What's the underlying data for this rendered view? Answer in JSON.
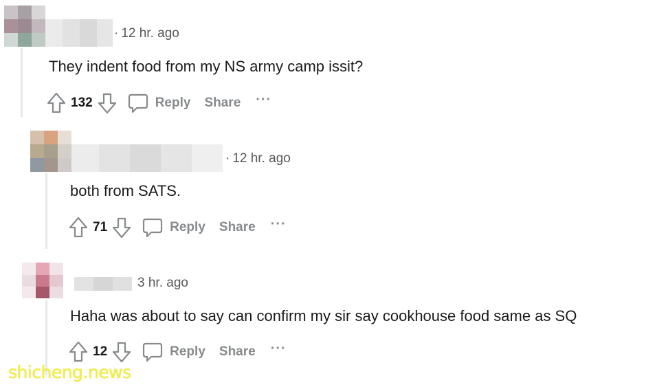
{
  "comments": [
    {
      "timestamp": "12 hr. ago",
      "body": "They indent food from my NS army camp issit?",
      "score": "132",
      "reply_label": "Reply",
      "share_label": "Share",
      "more_label": "···"
    },
    {
      "timestamp": "12 hr. ago",
      "body": "both from SATS.",
      "score": "71",
      "reply_label": "Reply",
      "share_label": "Share",
      "more_label": "···"
    },
    {
      "timestamp": "3 hr. ago",
      "body": "Haha was about to say can confirm my sir say cookhouse food same as SQ",
      "score": "12",
      "reply_label": "Reply",
      "share_label": "Share",
      "more_label": "···"
    }
  ],
  "icons": {
    "upvote": "upvote-arrow-icon",
    "downvote": "downvote-arrow-icon",
    "reply": "speech-bubble-icon",
    "more": "ellipsis-icon"
  },
  "colors": {
    "action_gray": "#878a8c",
    "thread_line": "#e6e7e8"
  },
  "watermark": "shicheng.news"
}
